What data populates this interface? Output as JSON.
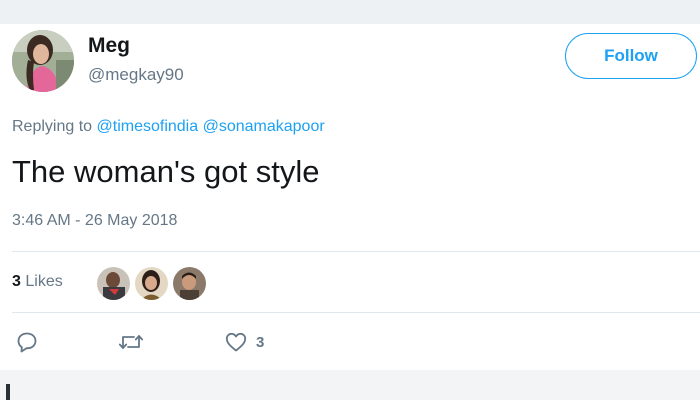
{
  "tweet": {
    "author": {
      "name": "Meg",
      "handle": "@megkay90",
      "avatar_icon": "profile-photo"
    },
    "follow_label": "Follow",
    "replying": {
      "prefix": "Replying to",
      "mentions": [
        "@timesofindia",
        "@sonamakapoor"
      ]
    },
    "text": "The woman's got style",
    "timestamp": "3:46 AM - 26 May 2018",
    "likes": {
      "count": "3",
      "label": "Likes"
    },
    "likers_icons": [
      "liker-avatar-1",
      "liker-avatar-2",
      "liker-avatar-3"
    ],
    "actions": {
      "reply_icon": "reply-icon",
      "retweet_icon": "retweet-icon",
      "like_icon": "heart-icon",
      "like_count": "3"
    }
  },
  "colors": {
    "accent": "#1da1f2",
    "secondary_text": "#657786",
    "primary_text": "#14171a"
  }
}
